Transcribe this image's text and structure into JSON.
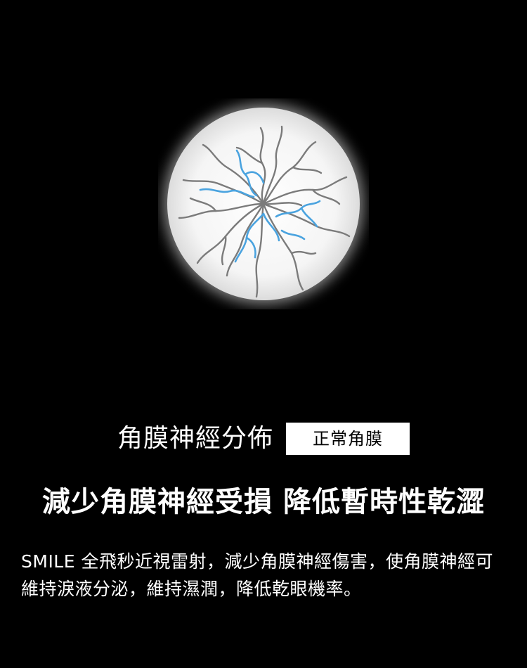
{
  "illustration": {
    "icon": "cornea-nerve-illustration-icon",
    "colors": {
      "normal_nerve": "#7b7b7b",
      "healthy_nerve": "#4aa3df",
      "cornea_fill": "#f4f4f4"
    }
  },
  "caption": {
    "label": "角膜神經分佈",
    "badge": "正常角膜"
  },
  "headline": "減少角膜神經受損 降低暫時性乾澀",
  "body": "SMILE 全飛秒近視雷射，減少角膜神經傷害，使角膜神經可維持淚液分泌，維持濕潤，降低乾眼機率。"
}
